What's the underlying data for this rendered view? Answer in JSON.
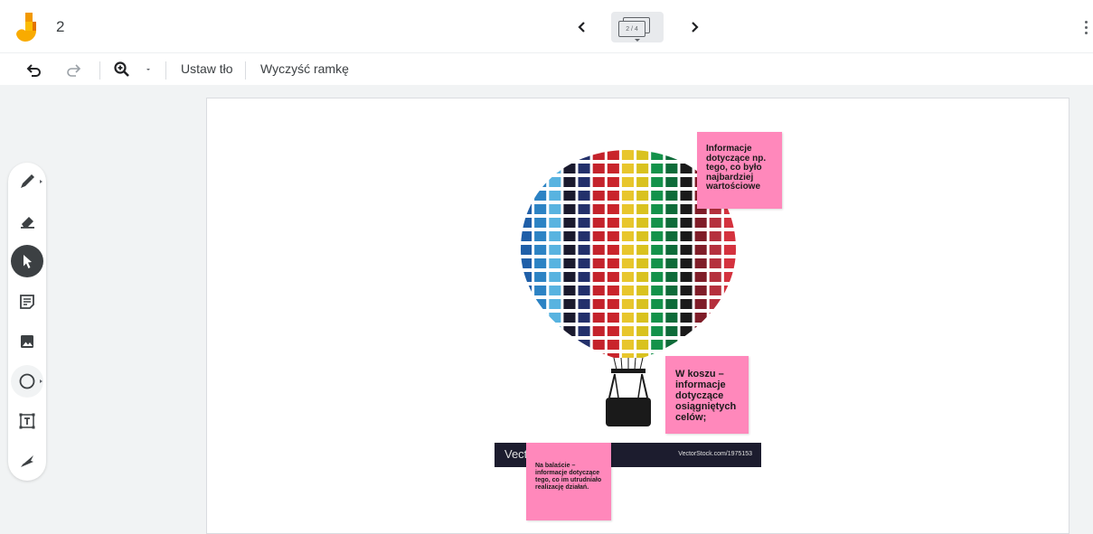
{
  "header": {
    "frame_number": "2",
    "frame_indicator": "2 / 4",
    "icons": {
      "logo": "jamboard-logo-icon",
      "prev": "chevron-left-icon",
      "next": "chevron-right-icon",
      "more": "more-vert-icon"
    }
  },
  "toolbar": {
    "set_background_label": "Ustaw tło",
    "clear_frame_label": "Wyczyść ramkę",
    "icons": [
      "undo-icon",
      "redo-icon",
      "zoom-icon",
      "dropdown-caret-icon"
    ]
  },
  "sidebar": {
    "tools": [
      "pen-icon",
      "eraser-icon",
      "select-icon",
      "sticky-note-icon",
      "image-icon",
      "circle-icon",
      "text-box-icon",
      "laser-icon"
    ],
    "active_tool": "select-icon"
  },
  "canvas": {
    "watermark_left": "Vect",
    "watermark_right": "VectorStock.com/1975153",
    "sticky_notes": [
      {
        "text": "Informacje dotyczące np. tego, co było najbardziej wartościowe",
        "color": "#ff88bb"
      },
      {
        "text": "W koszu – informacje dotyczące osiągniętych celów;",
        "color": "#ff88bb"
      },
      {
        "text": "Na balaście – informacje dotyczące tego, co im utrudniało realizację działań.",
        "color": "#ff88bb"
      }
    ]
  },
  "colors": {
    "accent_logo_orange": "#f29900",
    "accent_logo_yellow": "#fbbc04",
    "sticky_pink": "#ff88bb",
    "active_tool": "#3c4043"
  }
}
